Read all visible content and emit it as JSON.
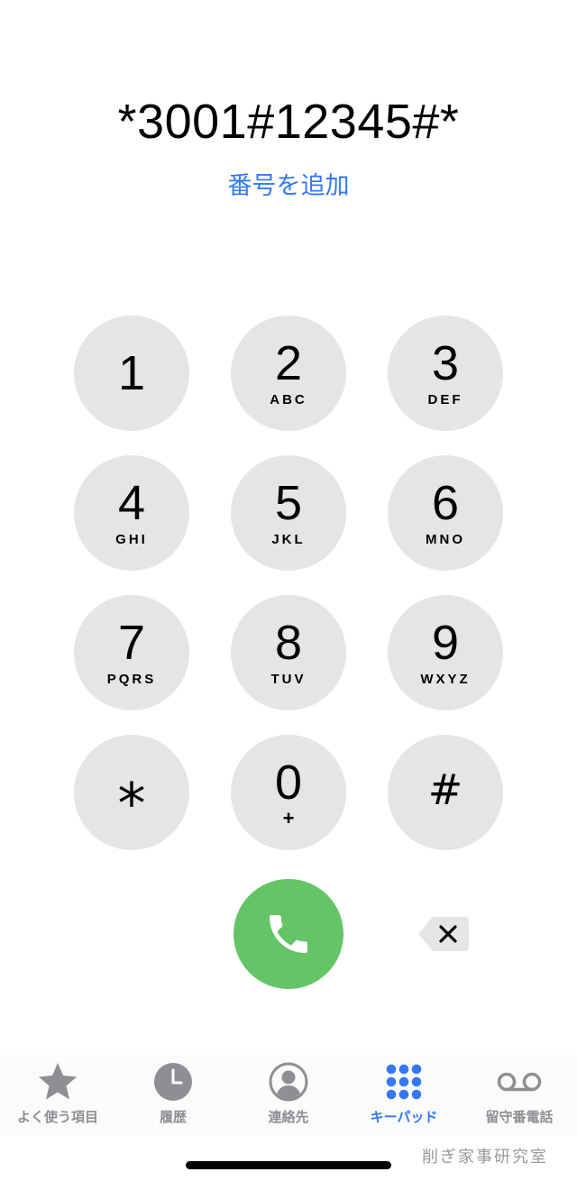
{
  "dialer": {
    "entered_number": "*3001#12345#*",
    "add_number_label": "番号を追加"
  },
  "keypad": {
    "k1": {
      "digit": "1",
      "letters": ""
    },
    "k2": {
      "digit": "2",
      "letters": "ABC"
    },
    "k3": {
      "digit": "3",
      "letters": "DEF"
    },
    "k4": {
      "digit": "4",
      "letters": "GHI"
    },
    "k5": {
      "digit": "5",
      "letters": "JKL"
    },
    "k6": {
      "digit": "6",
      "letters": "MNO"
    },
    "k7": {
      "digit": "7",
      "letters": "PQRS"
    },
    "k8": {
      "digit": "8",
      "letters": "TUV"
    },
    "k9": {
      "digit": "9",
      "letters": "WXYZ"
    },
    "kstar": {
      "digit": "*"
    },
    "k0": {
      "digit": "0",
      "letters": "+"
    },
    "khash": {
      "digit": "#"
    }
  },
  "actions": {
    "call_icon": "phone-icon",
    "delete_icon": "delete-backspace-icon"
  },
  "tab_bar": {
    "favorites": {
      "label": "よく使う項目",
      "icon": "star-icon"
    },
    "recents": {
      "label": "履歴",
      "icon": "clock-icon"
    },
    "contacts": {
      "label": "連絡先",
      "icon": "person-circle-icon"
    },
    "keypad": {
      "label": "キーパッド",
      "icon": "keypad-grid-icon",
      "active": true
    },
    "voicemail": {
      "label": "留守番電話",
      "icon": "voicemail-icon"
    }
  },
  "watermark": "削ぎ家事研究室",
  "colors": {
    "accent_blue": "#3478f6",
    "call_green": "#65c466",
    "key_gray": "#e5e5e5",
    "inactive_gray": "#8e8e93"
  }
}
